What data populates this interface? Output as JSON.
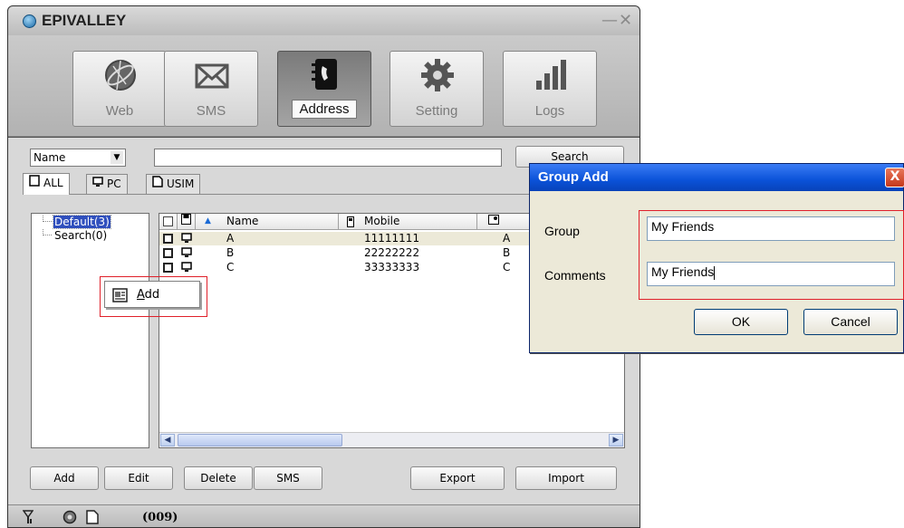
{
  "app": {
    "title": "EPIVALLEY",
    "minimize": "—",
    "close": "✕",
    "accent": "#1a6aa8"
  },
  "toolbar": {
    "items": [
      {
        "label": "Web",
        "icon": "globe-icon"
      },
      {
        "label": "SMS",
        "icon": "envelope-icon"
      },
      {
        "label": "Address",
        "icon": "address-book-icon",
        "active": true
      },
      {
        "label": "Setting",
        "icon": "gear-icon"
      },
      {
        "label": "Logs",
        "icon": "bar-chart-icon"
      }
    ]
  },
  "search": {
    "field": "Name",
    "query": "",
    "button_label": "Search"
  },
  "tabs": [
    {
      "label": "ALL",
      "active": true
    },
    {
      "label": "PC"
    },
    {
      "label": "USIM"
    }
  ],
  "groups": [
    {
      "label": "Default(3)",
      "selected": true
    },
    {
      "label": "Search(0)"
    }
  ],
  "list": {
    "columns": [
      "Name",
      "Mobile"
    ],
    "rows": [
      {
        "name": "A",
        "mobile": "11111111",
        "extra": "A"
      },
      {
        "name": "B",
        "mobile": "22222222",
        "extra": "B"
      },
      {
        "name": "C",
        "mobile": "33333333",
        "extra": "C"
      }
    ]
  },
  "buttons": {
    "add": "Add",
    "edit": "Edit",
    "delete": "Delete",
    "sms": "SMS",
    "export": "Export",
    "import": "Import"
  },
  "status": {
    "count": "(009)"
  },
  "context_menu": {
    "add": "Add",
    "add_rest": "dd",
    "add_mnemonic": "A"
  },
  "dialog": {
    "title": "Group Add",
    "close": "X",
    "group_label": "Group",
    "group_value": "My Friends",
    "comments_label": "Comments",
    "comments_value": "My Friends",
    "ok_label": "OK",
    "cancel_label": "Cancel",
    "title_color": "#0a52d8",
    "highlight_color": "#e0202a"
  }
}
